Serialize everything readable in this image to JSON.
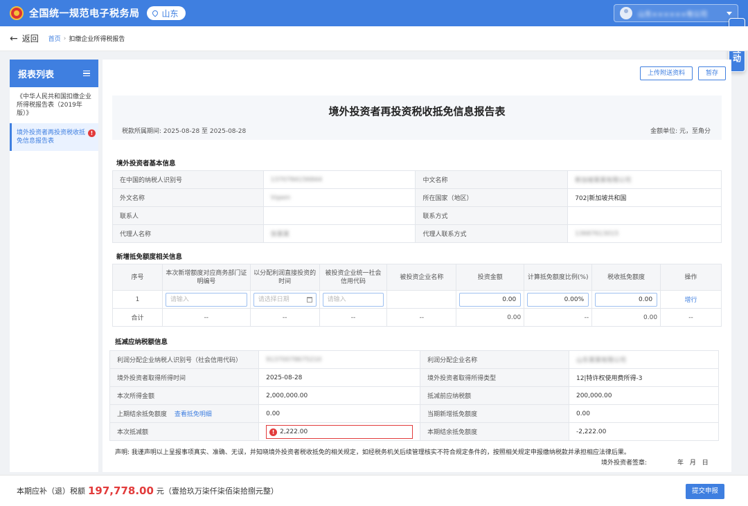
{
  "header": {
    "site_title": "全国统一规范电子税务局",
    "region": "山东",
    "user_name": "山东××××××有公司",
    "side_float": "征纳互动"
  },
  "breadcrumb": {
    "back": "返回",
    "home": "首页",
    "separator": "›",
    "current": "扣缴企业所得税报告"
  },
  "sidebar": {
    "title": "报表列表",
    "items": [
      {
        "label": "《中华人民共和国扣缴企业所得税报告表（2019年版）》"
      },
      {
        "label": "境外投资者再投资税收抵免信息报告表",
        "error_badge": "!"
      }
    ]
  },
  "toolbar": {
    "upload": "上传附送资料",
    "save": "暂存"
  },
  "report": {
    "title": "境外投资者再投资税收抵免信息报告表",
    "period": "税款所属期间:    2025-08-28 至 2025-08-28",
    "unit": "金额单位: 元，至角分"
  },
  "basic_info": {
    "section_title": "境外投资者基本信息",
    "rows": [
      {
        "l1": "在中国的纳税人识别号",
        "v1": "1370784156844",
        "l2": "中文名称",
        "v2": "新加坡某某有限公司"
      },
      {
        "l1": "外文名称",
        "v1": "Vqaen",
        "l2": "所在国家（地区）",
        "v2": "702|新加坡共和国"
      },
      {
        "l1": "联系人",
        "v1": "",
        "l2": "联系方式",
        "v2": ""
      },
      {
        "l1": "代理人名称",
        "v1": "张某某",
        "l2": "代理人联系方式",
        "v2": "13687613015"
      }
    ]
  },
  "new_quota": {
    "section_title": "新增抵免额度相关信息",
    "headers": [
      "序号",
      "本次新增额度对应商务部门证明编号",
      "以分配利润直接投资的时间",
      "被投资企业统一社会信用代码",
      "被投资企业名称",
      "投资金额",
      "计算抵免额度比例(%)",
      "税收抵免额度",
      "操作"
    ],
    "row": {
      "index": "1",
      "placeholder_input": "请输入",
      "placeholder_date": "请选择日期",
      "investment": "0.00",
      "ratio": "0.00%",
      "credit": "0.00",
      "action": "增行"
    },
    "total": {
      "label": "合计",
      "dash": "--",
      "investment": "0.00",
      "credit": "0.00"
    }
  },
  "deduction": {
    "section_title": "抵减应纳税额信息",
    "rows": [
      {
        "l1": "利润分配企业纳税人识别号（社会信用代码）",
        "v1": "91370078675210",
        "l2": "利润分配企业名称",
        "v2": "山东某某有限公司"
      },
      {
        "l1": "境外投资者取得所得时间",
        "v1": "2025-08-28",
        "l2": "境外投资者取得所得类型",
        "v2": "12|特许权使用费所得-3"
      },
      {
        "l1": "本次所得金额",
        "v1": "2,000,000.00",
        "l2": "抵减前应纳税额",
        "v2": "200,000.00"
      },
      {
        "l1": "上期结余抵免额度",
        "link": "查看抵免明细",
        "v1": "0.00",
        "l2": "当期新增抵免额度",
        "v2": "0.00"
      },
      {
        "l1": "本次抵减额",
        "v1": "2,222.00",
        "l2": "本期结余抵免额度",
        "v2": "-2,222.00"
      }
    ],
    "declaration": "声明: 我谨声明以上呈报事项真实、准确、无误，并知晓境外投资者税收抵免的相关规定，如经税务机关后续管理核实不符合规定条件的，按照相关规定申报缴纳税款并承担相应法律后果。",
    "signature_label": "境外投资者签章:",
    "date_label": "年  月  日"
  },
  "footer": {
    "prefix": "本期应补（退）税额",
    "amount": "197,778.00",
    "suffix": "元（壹拾玖万柒仟柒佰柒拾捌元整）",
    "submit": "提交申报"
  }
}
